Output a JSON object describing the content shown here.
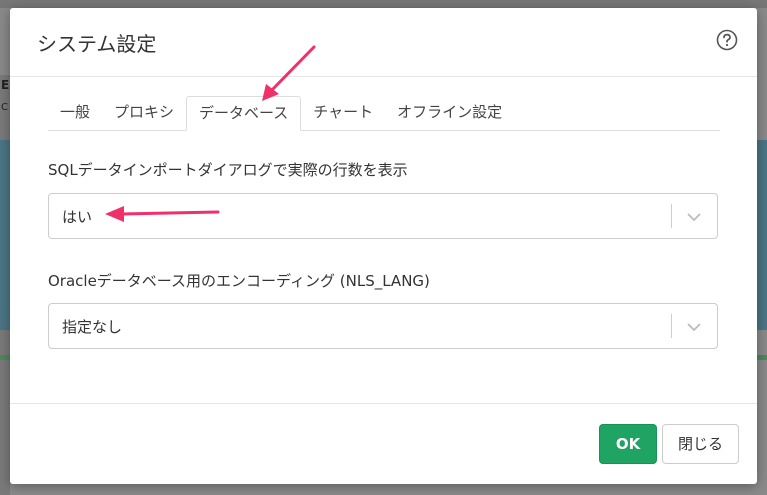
{
  "dialog": {
    "title": "システム設定",
    "help_icon": "question-circle-icon"
  },
  "tabs": [
    {
      "label": "一般",
      "active": false
    },
    {
      "label": "プロキシ",
      "active": false
    },
    {
      "label": "データベース",
      "active": true
    },
    {
      "label": "チャート",
      "active": false
    },
    {
      "label": "オフライン設定",
      "active": false
    }
  ],
  "fields": {
    "row_count": {
      "label": "SQLデータインポートダイアログで実際の行数を表示",
      "value": "はい",
      "icon": "chevron-down-icon"
    },
    "nls_lang": {
      "label": "Oracleデータベース用のエンコーディング (NLS_LANG)",
      "value": "指定なし",
      "icon": "chevron-down-icon"
    }
  },
  "footer": {
    "ok_label": "OK",
    "close_label": "閉じる"
  },
  "background": {
    "fragment_e": "E",
    "fragment_c": "C"
  },
  "colors": {
    "accent": "#1fa463",
    "annotation": "#f0306b"
  }
}
